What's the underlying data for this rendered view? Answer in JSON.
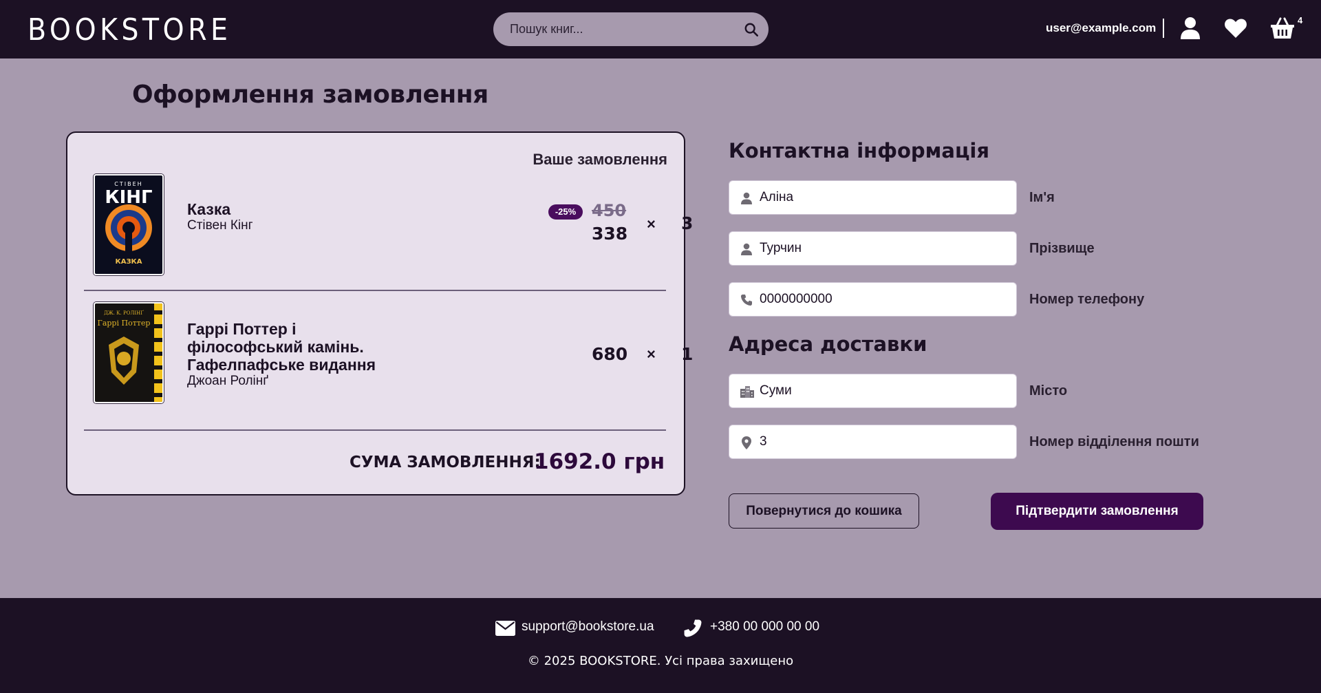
{
  "header": {
    "logo": "BOOKSTORE",
    "search_placeholder": "Пошук книг...",
    "user_email": "user@example.com",
    "cart_count": "4"
  },
  "page": {
    "title": "Оформлення замовлення"
  },
  "order": {
    "heading": "Ваше замовлення",
    "items": [
      {
        "title": "Казка",
        "author": "Стівен Кінг",
        "discount_badge": "-25%",
        "old_price": "450",
        "price": "338",
        "times": "×",
        "quantity": "3",
        "cover_lines": [
          "СТІВЕН",
          "КІНГ",
          "КАЗКА"
        ]
      },
      {
        "title": "Гаррі Поттер і філософський камінь. Гафелпафське видання",
        "author": "Джоан Ролінґ",
        "price": "680",
        "times": "×",
        "quantity": "1",
        "cover_lines": [
          "ДЖ. К. РОЛІНҐ",
          "Гаррі Поттер"
        ]
      }
    ],
    "total_label": "СУМА ЗАМОВЛЕННЯ:",
    "total_value": "1692.0 грн"
  },
  "contact": {
    "title": "Контактна інформація",
    "first_name": {
      "value": "Аліна",
      "label": "Ім'я",
      "icon": "person-icon"
    },
    "last_name": {
      "value": "Турчин",
      "label": "Прізвище",
      "icon": "person-icon"
    },
    "phone": {
      "value": "0000000000",
      "label": "Номер телефону",
      "icon": "phone-icon"
    }
  },
  "delivery": {
    "title": "Адреса доставки",
    "city": {
      "value": "Суми",
      "label": "Місто",
      "icon": "city-icon"
    },
    "branch": {
      "value": "3",
      "label": "Номер відділення пошти",
      "icon": "location-pin-icon"
    }
  },
  "actions": {
    "back": "Повернутися до кошика",
    "confirm": "Підтвердити замовлення"
  },
  "footer": {
    "email": "support@bookstore.ua",
    "phone": "+380 00 000 00 00",
    "copyright": "© 2025 BOOKSTORE. Усі права захищено"
  },
  "colors": {
    "header_bg": "#1c1124",
    "page_bg": "#a79aae",
    "card_bg": "#e8e0ec",
    "accent": "#3d0a4f"
  }
}
